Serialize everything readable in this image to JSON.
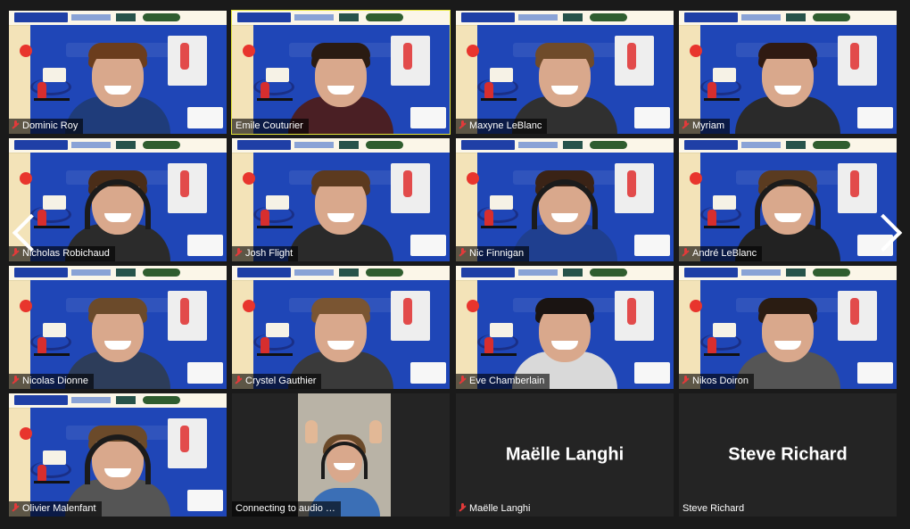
{
  "colors": {
    "tile_bg": "#242424",
    "stage_blue": "#1f46b7",
    "active_border": "#e6e63c",
    "muted_icon": "#e23a3a"
  },
  "participants": [
    {
      "name": "Dominic Roy",
      "muted": true,
      "headset": false,
      "shirt": "#1f3c7a",
      "hair": "#6b3d1d"
    },
    {
      "name": "Emile Couturier",
      "muted": false,
      "headset": false,
      "shirt": "#4a1f24",
      "hair": "#2a1b12",
      "active": true
    },
    {
      "name": "Maxyne LeBlanc",
      "muted": true,
      "headset": false,
      "shirt": "#303030",
      "hair": "#6f4b2a"
    },
    {
      "name": "Myriam",
      "muted": true,
      "headset": false,
      "shirt": "#2a2a2a",
      "hair": "#2f1a12"
    },
    {
      "name": "Nicholas Robichaud",
      "muted": true,
      "headset": true,
      "shirt": "#2b2b2b",
      "hair": "#4a2d18"
    },
    {
      "name": "Josh Flight",
      "muted": true,
      "headset": false,
      "shirt": "#2a2a2a",
      "hair": "#5c3a1f"
    },
    {
      "name": "Nic Finnigan",
      "muted": true,
      "headset": true,
      "shirt": "#1f3f8f",
      "hair": "#3a2316"
    },
    {
      "name": "André LeBlanc",
      "muted": true,
      "headset": true,
      "shirt": "#222",
      "hair": "#5a3b20"
    },
    {
      "name": "Nicolas Dionne",
      "muted": true,
      "headset": false,
      "shirt": "#2d3d5a",
      "hair": "#6b4a2a"
    },
    {
      "name": "Crystel Gauthier",
      "muted": true,
      "headset": false,
      "shirt": "#3a3a3a",
      "hair": "#7a5532"
    },
    {
      "name": "Eve Chamberlain",
      "muted": true,
      "headset": false,
      "shirt": "#d9d9d9",
      "hair": "#1a1412"
    },
    {
      "name": "Nikos Doiron",
      "muted": true,
      "headset": false,
      "shirt": "#555",
      "hair": "#2a1c12"
    },
    {
      "name": "Olivier Malenfant",
      "muted": true,
      "headset": true,
      "shirt": "#555",
      "hair": "#6b4a2a"
    }
  ],
  "audio_tile": {
    "label": "Connecting to audio"
  },
  "text_tiles": [
    {
      "big": "Maëlle Langhi",
      "label": "Maëlle Langhi",
      "muted": true
    },
    {
      "big": "Steve Richard",
      "label": "Steve Richard",
      "muted": false
    }
  ]
}
